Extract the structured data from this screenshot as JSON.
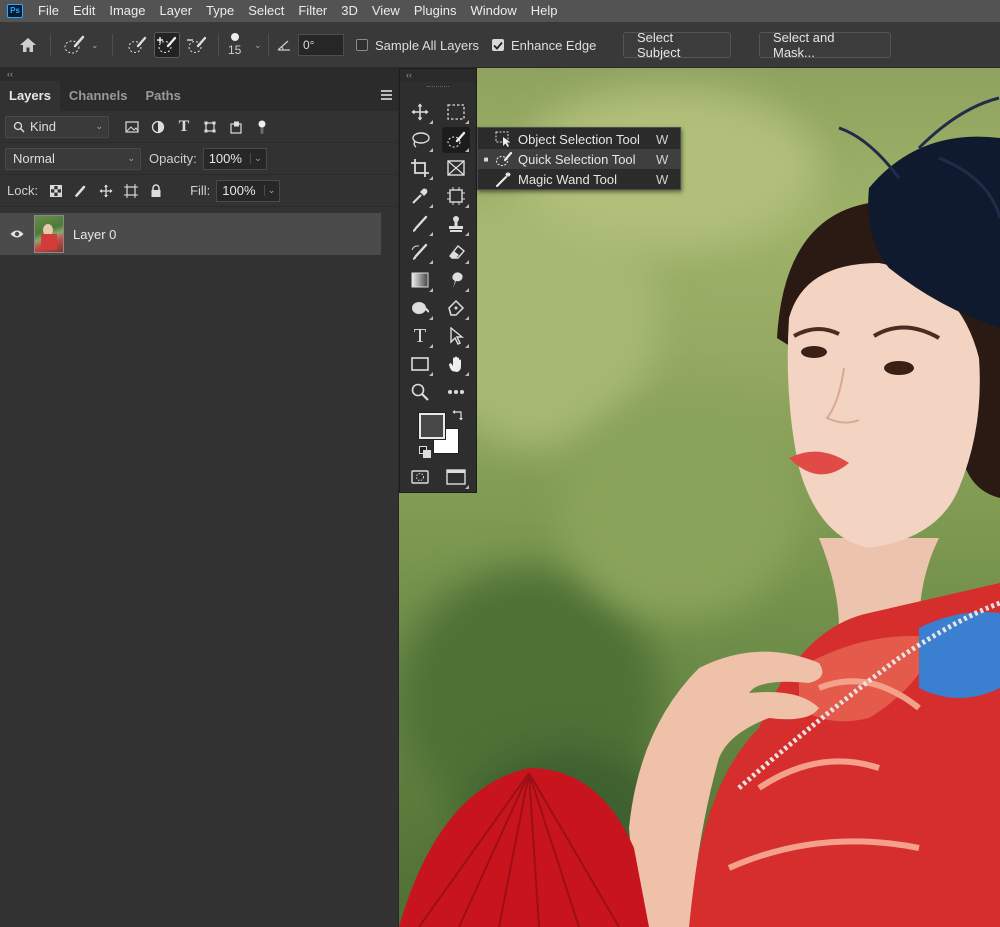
{
  "app": {
    "logo": "Ps"
  },
  "menu": [
    "File",
    "Edit",
    "Image",
    "Layer",
    "Type",
    "Select",
    "Filter",
    "3D",
    "View",
    "Plugins",
    "Window",
    "Help"
  ],
  "options": {
    "brush_size": "15",
    "angle": "0°",
    "sample_all_layers": {
      "label": "Sample All Layers",
      "checked": false
    },
    "enhance_edge": {
      "label": "Enhance Edge",
      "checked": true
    },
    "select_subject": "Select Subject",
    "select_and_mask": "Select and Mask..."
  },
  "panel": {
    "collapse": "‹‹",
    "tabs": [
      "Layers",
      "Channels",
      "Paths"
    ],
    "active_tab": "Layers",
    "filter_kind": "Kind",
    "blend_mode": "Normal",
    "opacity_label": "Opacity:",
    "opacity_value": "100%",
    "lock_label": "Lock:",
    "fill_label": "Fill:",
    "fill_value": "100%",
    "layers": [
      {
        "name": "Layer 0",
        "visible": true
      }
    ]
  },
  "toolbar": {
    "collapse": "‹‹"
  },
  "flyout": {
    "items": [
      {
        "name": "Object Selection Tool",
        "key": "W",
        "active": false
      },
      {
        "name": "Quick Selection Tool",
        "key": "W",
        "active": true
      },
      {
        "name": "Magic Wand Tool",
        "key": "W",
        "active": false
      }
    ]
  }
}
